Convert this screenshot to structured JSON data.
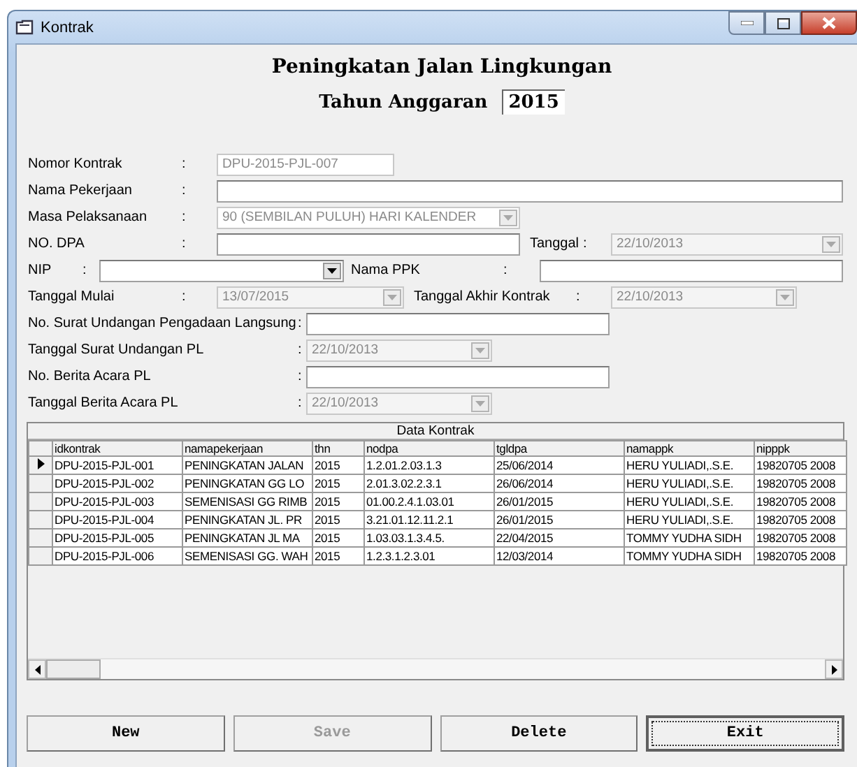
{
  "window": {
    "title": "Kontrak"
  },
  "form_title": "Peningkatan Jalan Lingkungan",
  "budget_year": {
    "label": "Tahun Anggaran",
    "value": "2015"
  },
  "form_rows": [
    {
      "fields": [
        {
          "label": "Nomor Kontrak",
          "separator": ":",
          "kind": "text",
          "value": "DPU-2015-PJL-007",
          "disabled": true
        }
      ]
    },
    {
      "fields": [
        {
          "label": "Nama Pekerjaan",
          "separator": ":",
          "kind": "text",
          "disabled": false
        }
      ]
    },
    {
      "fields": [
        {
          "label": "Masa Pelaksanaan",
          "separator": ":",
          "kind": "combo",
          "value": "90 (SEMBILAN PULUH) HARI KALENDER",
          "disabled": true
        }
      ]
    },
    {
      "fields": [
        {
          "label": "NO. DPA",
          "separator": ":",
          "kind": "text",
          "disabled": false
        },
        {
          "label": "Tanggal",
          "separator": ":",
          "kind": "date",
          "value": "22/10/2013",
          "disabled": true
        }
      ]
    },
    {
      "fields": [
        {
          "label": "NIP",
          "separator": ":",
          "kind": "combo",
          "disabled": false
        },
        {
          "label": "Nama PPK",
          "separator": ":",
          "kind": "text",
          "disabled": false
        }
      ]
    },
    {
      "fields": [
        {
          "label": "Tanggal Mulai",
          "separator": ":",
          "kind": "date",
          "value": "13/07/2015",
          "disabled": true
        },
        {
          "label": "Tanggal Akhir Kontrak",
          "separator": ":",
          "kind": "date",
          "value": "22/10/2013",
          "disabled": true
        }
      ]
    },
    {
      "fields": [
        {
          "label": "No. Surat Undangan Pengadaan Langsung",
          "separator": ":",
          "kind": "text",
          "disabled": false
        }
      ]
    },
    {
      "fields": [
        {
          "label": "Tanggal Surat Undangan PL",
          "separator": ":",
          "kind": "date",
          "value": "22/10/2013",
          "disabled": true
        }
      ]
    },
    {
      "fields": [
        {
          "label": "No. Berita Acara PL",
          "separator": ":",
          "kind": "text",
          "disabled": false
        }
      ]
    },
    {
      "fields": [
        {
          "label": "Tanggal Berita Acara PL",
          "separator": ":",
          "kind": "date",
          "value": "22/10/2013",
          "disabled": true
        }
      ]
    }
  ],
  "grid": {
    "caption": "Data Kontrak",
    "columns": [
      "idkontrak",
      "namapekerjaan",
      "thn",
      "nodpa",
      "tgldpa",
      "namappk",
      "nipppk"
    ],
    "rows": [
      {
        "selected": true,
        "cells": [
          "DPU-2015-PJL-001",
          "PENINGKATAN JALAN",
          "2015",
          "1.2.01.2.03.1.3",
          "25/06/2014",
          "HERU YULIADI,.S.E.",
          "19820705 2008"
        ]
      },
      {
        "selected": false,
        "cells": [
          "DPU-2015-PJL-002",
          "PENINGKATAN GG LO",
          "2015",
          "2.01.3.02.2.3.1",
          "26/06/2014",
          "HERU YULIADI,.S.E.",
          "19820705 2008"
        ]
      },
      {
        "selected": false,
        "cells": [
          "DPU-2015-PJL-003",
          "SEMENISASI GG RIMB",
          "2015",
          "01.00.2.4.1.03.01",
          "26/01/2015",
          "HERU YULIADI,.S.E.",
          "19820705 2008"
        ]
      },
      {
        "selected": false,
        "cells": [
          "DPU-2015-PJL-004",
          "PENINGKATAN JL. PR",
          "2015",
          "3.21.01.12.11.2.1",
          "26/01/2015",
          "HERU YULIADI,.S.E.",
          "19820705 2008"
        ]
      },
      {
        "selected": false,
        "cells": [
          "DPU-2015-PJL-005",
          "PENINGKATAN JL MA",
          "2015",
          "1.03.03.1.3.4.5.",
          "22/04/2015",
          "TOMMY YUDHA SIDH",
          "19820705 2008"
        ]
      },
      {
        "selected": false,
        "cells": [
          "DPU-2015-PJL-006",
          "SEMENISASI GG. WAH",
          "2015",
          "1.2.3.1.2.3.01",
          "12/03/2014",
          "TOMMY YUDHA SIDH",
          "19820705 2008"
        ]
      }
    ]
  },
  "buttons": [
    {
      "label": "New",
      "disabled": false,
      "focused": false
    },
    {
      "label": "Save",
      "disabled": true,
      "focused": false
    },
    {
      "label": "Delete",
      "disabled": false,
      "focused": false
    },
    {
      "label": "Exit",
      "disabled": false,
      "focused": true
    }
  ]
}
